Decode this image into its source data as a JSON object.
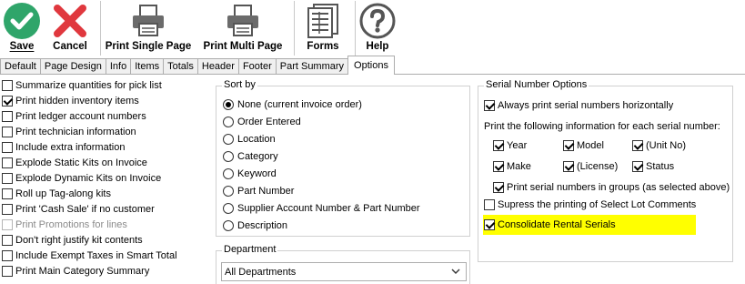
{
  "toolbar": {
    "save_label": "Save",
    "cancel_label": "Cancel",
    "print_single_label": "Print Single Page",
    "print_multi_label": "Print Multi Page",
    "forms_label": "Forms",
    "help_label": "Help"
  },
  "tabs": [
    "Default",
    "Page Design",
    "Info",
    "Items",
    "Totals",
    "Header",
    "Footer",
    "Part Summary",
    "Options"
  ],
  "active_tab": "Options",
  "options": [
    {
      "label": "Summarize quantities for pick list",
      "checked": false,
      "disabled": false
    },
    {
      "label": "Print hidden inventory items",
      "checked": true,
      "disabled": false
    },
    {
      "label": "Print ledger account numbers",
      "checked": false,
      "disabled": false
    },
    {
      "label": "Print technician information",
      "checked": false,
      "disabled": false
    },
    {
      "label": "Include extra information",
      "checked": false,
      "disabled": false
    },
    {
      "label": "Explode Static Kits on Invoice",
      "checked": false,
      "disabled": false
    },
    {
      "label": "Explode Dynamic Kits on Invoice",
      "checked": false,
      "disabled": false
    },
    {
      "label": "Roll up Tag-along kits",
      "checked": false,
      "disabled": false
    },
    {
      "label": "Print 'Cash Sale' if no customer",
      "checked": false,
      "disabled": false
    },
    {
      "label": "Print Promotions for lines",
      "checked": false,
      "disabled": true
    },
    {
      "label": "Don't right justify kit contents",
      "checked": false,
      "disabled": false
    },
    {
      "label": "Include Exempt Taxes in Smart Total",
      "checked": false,
      "disabled": false
    },
    {
      "label": "Print Main Category Summary",
      "checked": false,
      "disabled": false
    }
  ],
  "sort_by": {
    "legend": "Sort by",
    "items": [
      {
        "label": "None (current invoice order)",
        "selected": true
      },
      {
        "label": "Order Entered",
        "selected": false
      },
      {
        "label": "Location",
        "selected": false
      },
      {
        "label": "Category",
        "selected": false
      },
      {
        "label": "Keyword",
        "selected": false
      },
      {
        "label": "Part Number",
        "selected": false
      },
      {
        "label": "Supplier Account Number & Part Number",
        "selected": false
      },
      {
        "label": "Description",
        "selected": false
      }
    ]
  },
  "department": {
    "legend": "Department",
    "value": "All Departments"
  },
  "serial": {
    "legend": "Serial Number Options",
    "horizontal_label": "Always print serial numbers horizontally",
    "horizontal_checked": true,
    "info_text": "Print the following information for each serial number:",
    "fields": [
      {
        "label": "Year",
        "checked": true
      },
      {
        "label": "Model",
        "checked": true
      },
      {
        "label": "(Unit No)",
        "checked": true
      },
      {
        "label": "Make",
        "checked": true
      },
      {
        "label": "(License)",
        "checked": true
      },
      {
        "label": "Status",
        "checked": true
      }
    ],
    "groups_label": "Print serial numbers in groups (as selected above)",
    "groups_checked": true,
    "suppress_label": "Supress the printing of Select Lot Comments",
    "suppress_checked": false,
    "consolidate_label": "Consolidate Rental Serials",
    "consolidate_checked": true
  },
  "colors": {
    "save_green": "#2fa56a",
    "cancel_red": "#e0383e",
    "highlight": "#ffff00"
  }
}
